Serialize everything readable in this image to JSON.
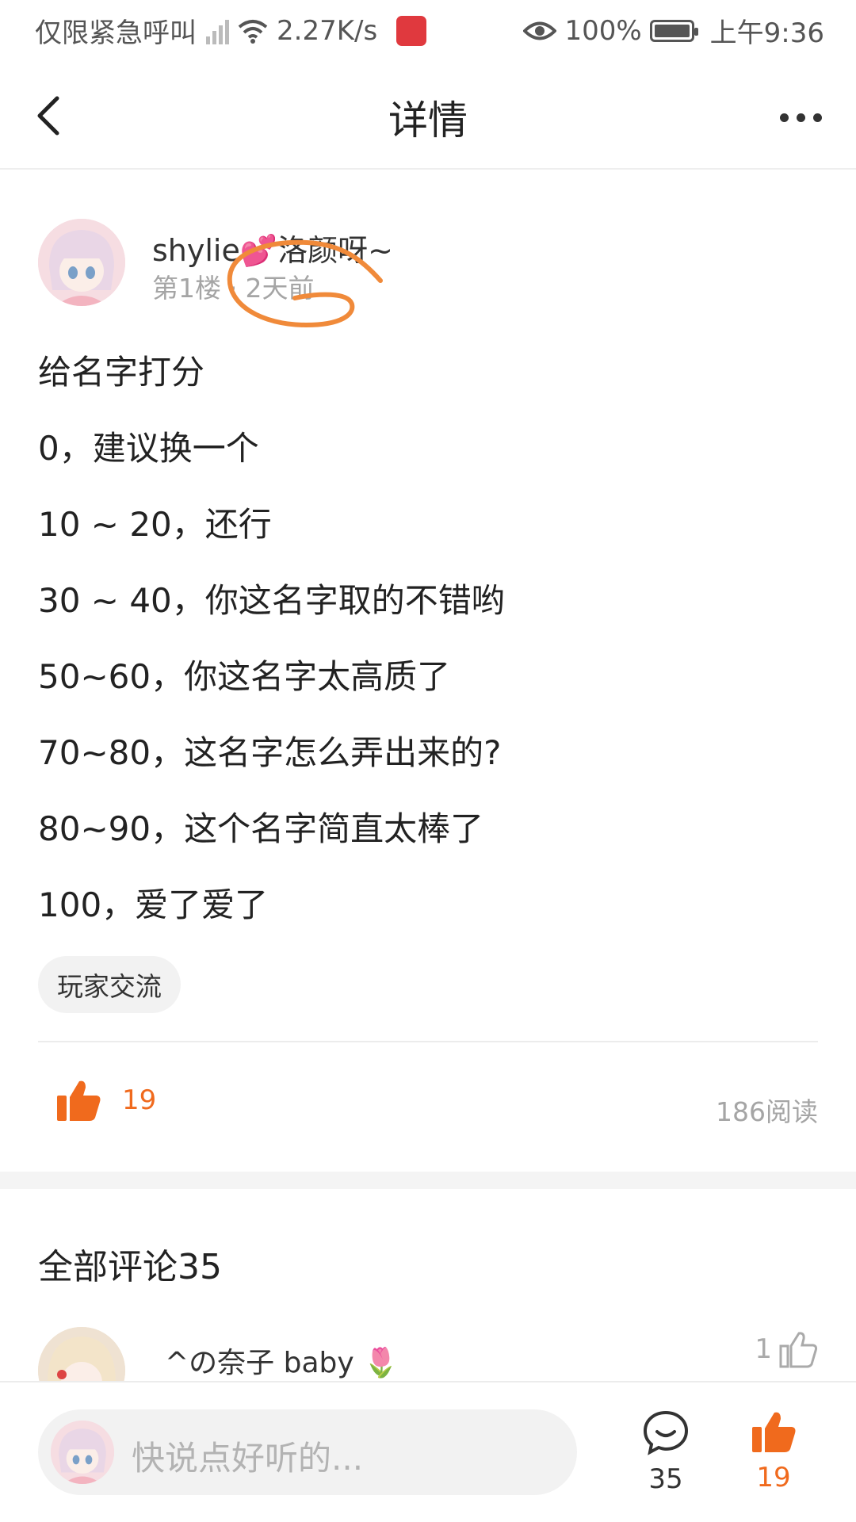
{
  "status_bar": {
    "carrier_text": "仅限紧急呼叫",
    "net_speed": "2.27K/s",
    "battery": "100%",
    "time": "上午9:36"
  },
  "header": {
    "title": "详情"
  },
  "post": {
    "author": "shylie💕洛颜呀~",
    "floor": "第1楼",
    "separator": "·",
    "time": "2天前",
    "lines": [
      "给名字打分",
      "0，建议换一个",
      "10 ~ 20，还行",
      "30 ~ 40，你这名字取的不错哟",
      "50~60，你这名字太高质了",
      "70~80，这名字怎么弄出来的?",
      "80~90，这个名字简直太棒了",
      "100，爱了爱了"
    ],
    "tag": "玩家交流",
    "likes": "19",
    "reads": "186阅读"
  },
  "comments": {
    "title": "全部评论35",
    "first": {
      "name": "^の奈子 baby 🌷",
      "likes": "1"
    }
  },
  "bottom_bar": {
    "input_placeholder": "快说点好听的...",
    "comment_count": "35",
    "like_count": "19"
  },
  "colors": {
    "accent": "#f06a1d",
    "annotation": "#f08a3a",
    "muted_text": "#a5a5a5"
  }
}
